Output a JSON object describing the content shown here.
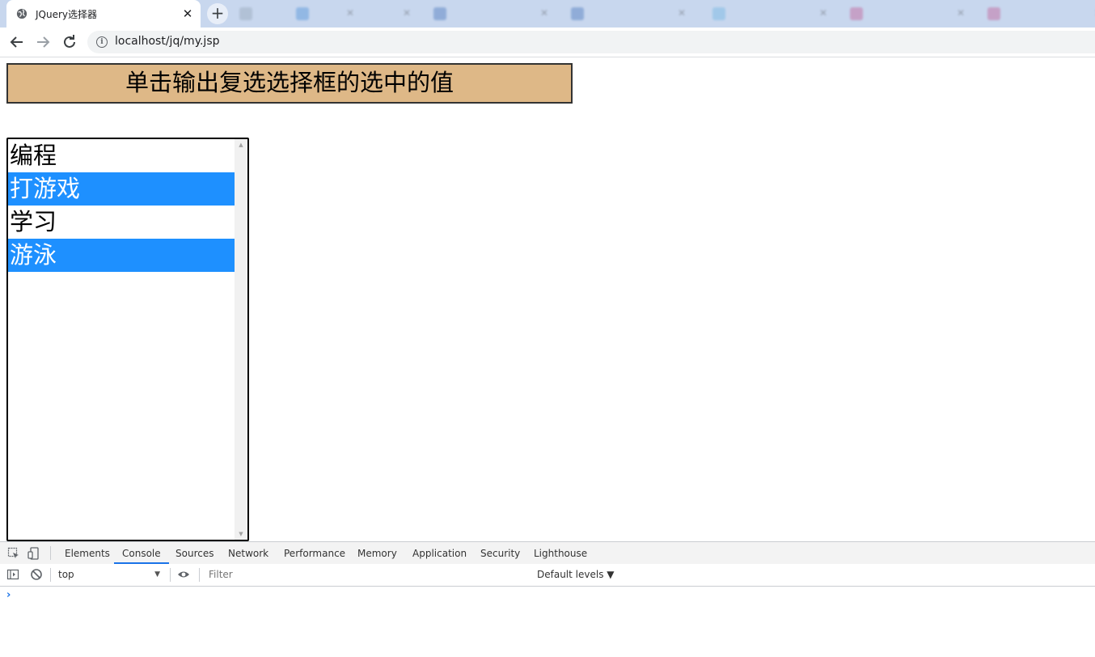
{
  "browser": {
    "active_tab_title": "JQuery选择器",
    "new_tab_symbol": "+",
    "close_symbol": "✕",
    "background_tabs": [
      {
        "title": "",
        "color": "#8899aa"
      },
      {
        "title": "",
        "color": "#2f7fd3"
      },
      {
        "title": "",
        "color": "#2a5fb0"
      },
      {
        "title": "",
        "color": "#2a5fb0"
      },
      {
        "title": "",
        "color": "#5aaee0"
      },
      {
        "title": "",
        "color": "#c04080"
      },
      {
        "title": "",
        "color": "#c04080"
      }
    ],
    "url": "localhost/jq/my.jsp"
  },
  "page": {
    "button_label": "单击输出复选选择框的选中的值",
    "button_color": "#deb887",
    "listbox": {
      "options": [
        {
          "label": "编程",
          "selected": false
        },
        {
          "label": "打游戏",
          "selected": true
        },
        {
          "label": "学习",
          "selected": false
        },
        {
          "label": "游泳",
          "selected": true
        }
      ],
      "selected_color": "#1e90ff"
    }
  },
  "devtools": {
    "tabs": [
      "Elements",
      "Console",
      "Sources",
      "Network",
      "Performance",
      "Memory",
      "Application",
      "Security",
      "Lighthouse"
    ],
    "active_tab": "Console",
    "context": "top",
    "filter_placeholder": "Filter",
    "levels_label": "Default levels ▼",
    "prompt_symbol": "›"
  }
}
